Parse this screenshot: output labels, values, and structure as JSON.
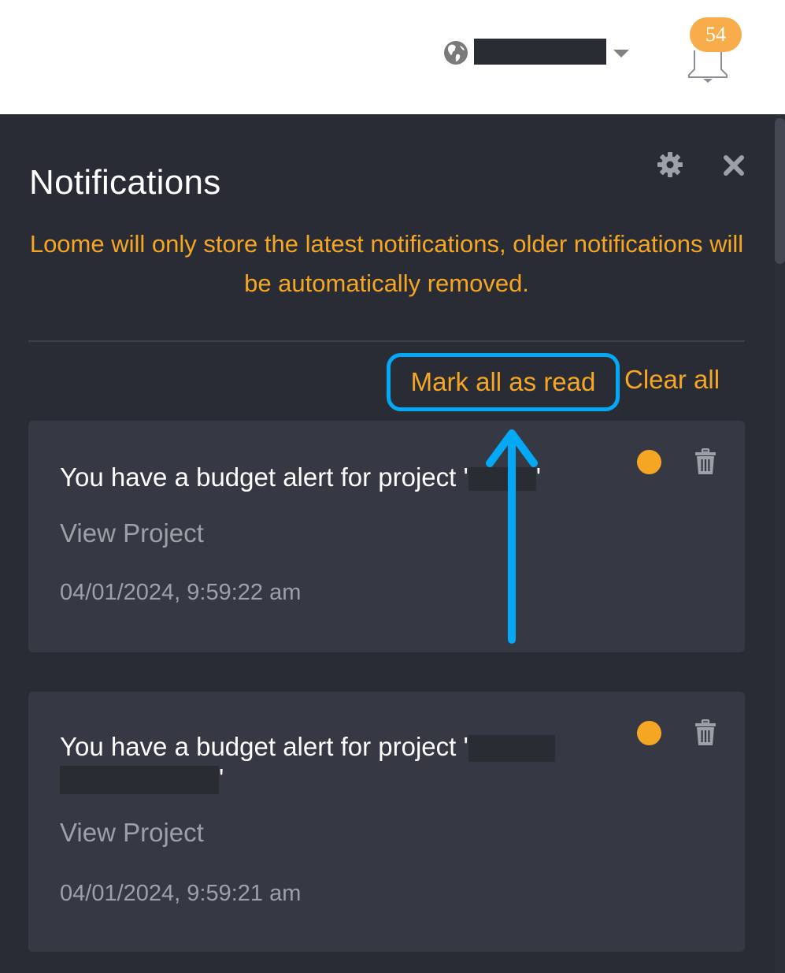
{
  "header": {
    "account_name": "[redacted]",
    "notification_count": "54",
    "icons": {
      "globe": "globe-icon",
      "caret": "caret-down-icon",
      "bell": "bell-icon"
    }
  },
  "panel": {
    "title": "Notifications",
    "notice": "Loome will only store the latest notifications, older notifications will be automatically removed.",
    "actions": {
      "mark_all_read": "Mark all as read",
      "clear_all": "Clear all"
    },
    "icons": {
      "settings": "gear-icon",
      "close": "close-icon"
    }
  },
  "notifications": [
    {
      "message_prefix": "You have a budget alert for project '",
      "project_name": "[redacted]",
      "message_suffix": "'",
      "link": "View Project",
      "timestamp": "04/01/2024, 9:59:22 am",
      "unread": true
    },
    {
      "message_prefix": "You have a budget alert for project '",
      "project_name": "[redacted]",
      "message_suffix": "'",
      "link": "View Project",
      "timestamp": "04/01/2024, 9:59:21 am",
      "unread": true
    }
  ],
  "colors": {
    "accent": "#f5a623",
    "highlight": "#03a9f4",
    "panel_bg": "#2a2c35",
    "card_bg": "#363843",
    "muted_text": "#9ca0a8"
  },
  "annotation": {
    "type": "arrow pointing to Mark all as read button"
  }
}
